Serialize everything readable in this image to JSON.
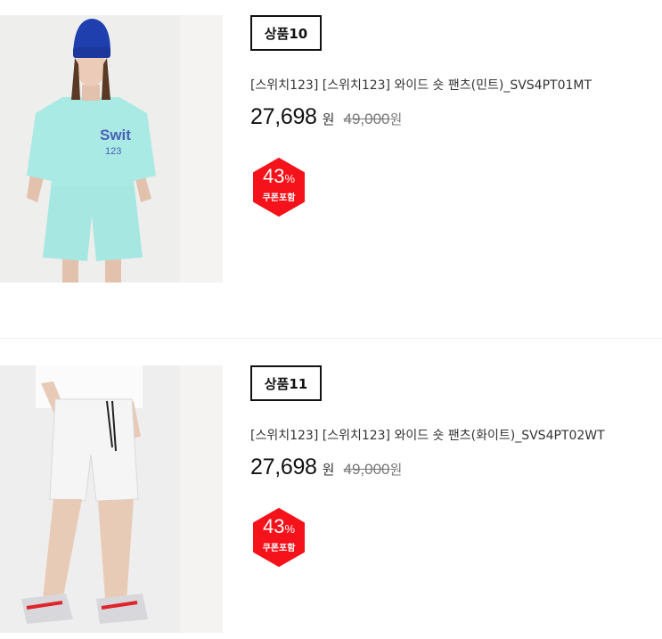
{
  "products": [
    {
      "badge": "상품10",
      "title": "[스위치123] [스위치123] 와이드 숏 팬츠(민트)_SVS4PT01MT",
      "price": "27,698",
      "currency": "원",
      "original_price": "49,000",
      "original_currency": "원",
      "discount": "43",
      "discount_unit": "%",
      "coupon_label": "쿠폰포함",
      "image_alt": "model wearing mint t-shirt and shorts with blue beanie"
    },
    {
      "badge": "상품11",
      "title": "[스위치123] [스위치123] 와이드 숏 팬츠(화이트)_SVS4PT02WT",
      "price": "27,698",
      "currency": "원",
      "original_price": "49,000",
      "original_currency": "원",
      "discount": "43",
      "discount_unit": "%",
      "coupon_label": "쿠폰포함",
      "image_alt": "model wearing white shorts and sneakers"
    }
  ],
  "colors": {
    "coupon_red": "#f5121a",
    "mint": "#a9e9e3",
    "beanie_blue": "#1f3fae"
  }
}
